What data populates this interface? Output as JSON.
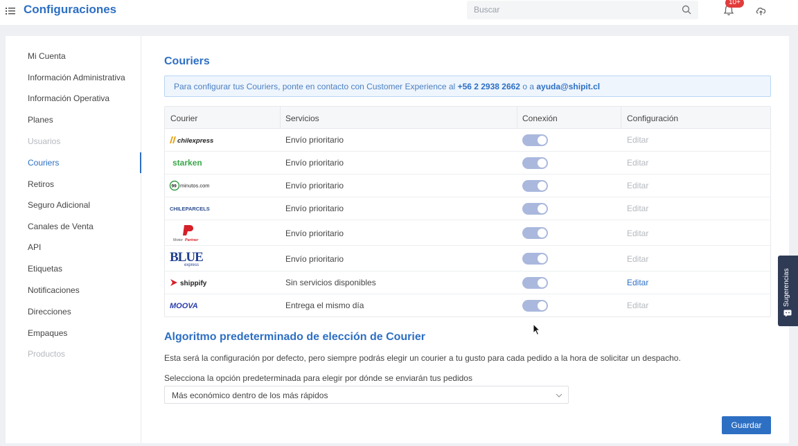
{
  "header": {
    "title": "Configuraciones",
    "search_placeholder": "Buscar",
    "notification_badge": "10+"
  },
  "sidebar": {
    "items": [
      {
        "label": "Mi Cuenta",
        "state": "normal"
      },
      {
        "label": "Información Administrativa",
        "state": "normal"
      },
      {
        "label": "Información Operativa",
        "state": "normal"
      },
      {
        "label": "Planes",
        "state": "normal"
      },
      {
        "label": "Usuarios",
        "state": "disabled"
      },
      {
        "label": "Couriers",
        "state": "active"
      },
      {
        "label": "Retiros",
        "state": "normal"
      },
      {
        "label": "Seguro Adicional",
        "state": "normal"
      },
      {
        "label": "Canales de Venta",
        "state": "normal"
      },
      {
        "label": "API",
        "state": "normal"
      },
      {
        "label": "Etiquetas",
        "state": "normal"
      },
      {
        "label": "Notificaciones",
        "state": "normal"
      },
      {
        "label": "Direcciones",
        "state": "normal"
      },
      {
        "label": "Empaques",
        "state": "normal"
      },
      {
        "label": "Productos",
        "state": "disabled"
      }
    ]
  },
  "main": {
    "title": "Couriers",
    "banner": {
      "text": "Para configurar tus Couriers, ponte en contacto con Customer Experience al",
      "phone": "+56 2 2938 2662",
      "connector": "o a",
      "email": "ayuda@shipit.cl"
    },
    "table": {
      "headers": [
        "Courier",
        "Servicios",
        "Conexión",
        "Configuración"
      ],
      "rows": [
        {
          "logo_text": "chilexpress",
          "service": "Envío prioritario",
          "connected": true,
          "edit": "Editar",
          "edit_enabled": false
        },
        {
          "logo_text": "starken",
          "service": "Envío prioritario",
          "connected": true,
          "edit": "Editar",
          "edit_enabled": false
        },
        {
          "logo_text": "minutos.com",
          "logo_prefix": "99",
          "service": "Envío prioritario",
          "connected": true,
          "edit": "Editar",
          "edit_enabled": false
        },
        {
          "logo_text": "CHILEPARCELS",
          "service": "Envío prioritario",
          "connected": true,
          "edit": "Editar",
          "edit_enabled": false
        },
        {
          "logo_text": "Partner",
          "logo_prefix": "Motor",
          "service": "Envío prioritario",
          "connected": true,
          "edit": "Editar",
          "edit_enabled": false
        },
        {
          "logo_text": "BLUE",
          "logo_sub": "express",
          "service": "Envío prioritario",
          "connected": true,
          "edit": "Editar",
          "edit_enabled": false
        },
        {
          "logo_text": "shippify",
          "service": "Sin servicios disponibles",
          "connected": true,
          "edit": "Editar",
          "edit_enabled": true
        },
        {
          "logo_text": "MOOVA",
          "service": "Entrega el mismo día",
          "connected": true,
          "edit": "Editar",
          "edit_enabled": false
        }
      ]
    },
    "algorithm": {
      "title": "Algoritmo predeterminado de elección de Courier",
      "description": "Esta será la configuración por defecto, pero siempre podrás elegir un courier a tu gusto para cada pedido a la hora de solicitar un despacho.",
      "select_label": "Selecciona la opción predeterminada para elegir por dónde se enviarán tus pedidos",
      "selected_option": "Más económico dentro de los más rápidos"
    },
    "save_label": "Guardar"
  },
  "feedback_tab": {
    "label": "Sugerencias"
  },
  "colors": {
    "accent": "#2d6fc3",
    "toggle_on": "#aab8dd",
    "badge": "#e23a3a"
  }
}
